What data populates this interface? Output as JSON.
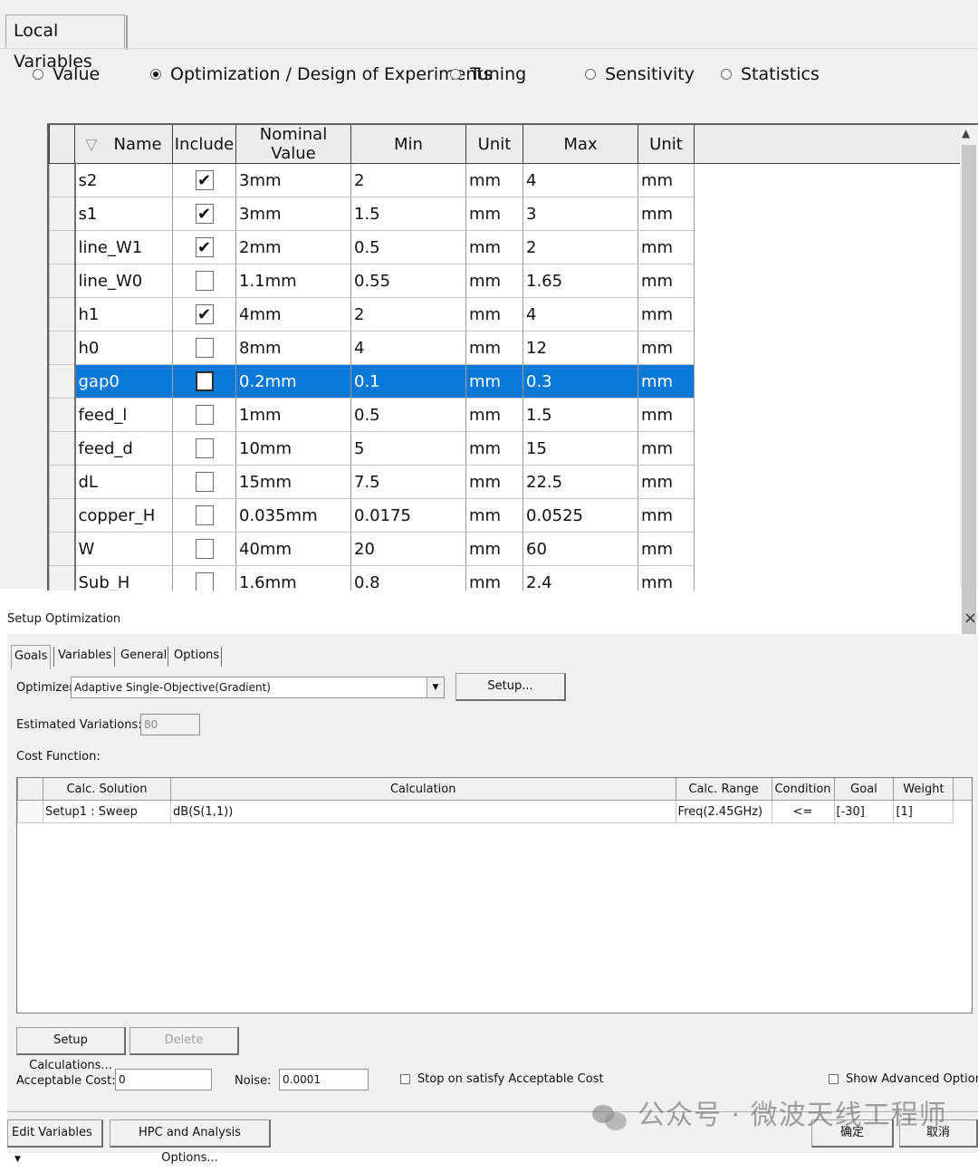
{
  "local_variables": {
    "tab_label": "Local Variables",
    "radio_options": [
      {
        "label": "Value",
        "selected": false
      },
      {
        "label": "Optimization / Design of Experiments",
        "selected": true
      },
      {
        "label": "Tuning",
        "selected": false
      },
      {
        "label": "Sensitivity",
        "selected": false
      },
      {
        "label": "Statistics",
        "selected": false
      }
    ],
    "columns": [
      "Name",
      "Include",
      "Nominal Value",
      "Min",
      "Unit",
      "Max",
      "Unit"
    ],
    "rows": [
      {
        "name": "s2",
        "include": true,
        "nominal": "3mm",
        "min": "2",
        "min_unit": "mm",
        "max": "4",
        "max_unit": "mm",
        "selected": false
      },
      {
        "name": "s1",
        "include": true,
        "nominal": "3mm",
        "min": "1.5",
        "min_unit": "mm",
        "max": "3",
        "max_unit": "mm",
        "selected": false
      },
      {
        "name": "line_W1",
        "include": true,
        "nominal": "2mm",
        "min": "0.5",
        "min_unit": "mm",
        "max": "2",
        "max_unit": "mm",
        "selected": false
      },
      {
        "name": "line_W0",
        "include": false,
        "nominal": "1.1mm",
        "min": "0.55",
        "min_unit": "mm",
        "max": "1.65",
        "max_unit": "mm",
        "selected": false
      },
      {
        "name": "h1",
        "include": true,
        "nominal": "4mm",
        "min": "2",
        "min_unit": "mm",
        "max": "4",
        "max_unit": "mm",
        "selected": false
      },
      {
        "name": "h0",
        "include": false,
        "nominal": "8mm",
        "min": "4",
        "min_unit": "mm",
        "max": "12",
        "max_unit": "mm",
        "selected": false
      },
      {
        "name": "gap0",
        "include": false,
        "nominal": "0.2mm",
        "min": "0.1",
        "min_unit": "mm",
        "max": "0.3",
        "max_unit": "mm",
        "selected": true
      },
      {
        "name": "feed_l",
        "include": false,
        "nominal": "1mm",
        "min": "0.5",
        "min_unit": "mm",
        "max": "1.5",
        "max_unit": "mm",
        "selected": false
      },
      {
        "name": "feed_d",
        "include": false,
        "nominal": "10mm",
        "min": "5",
        "min_unit": "mm",
        "max": "15",
        "max_unit": "mm",
        "selected": false
      },
      {
        "name": "dL",
        "include": false,
        "nominal": "15mm",
        "min": "7.5",
        "min_unit": "mm",
        "max": "22.5",
        "max_unit": "mm",
        "selected": false
      },
      {
        "name": "copper_H",
        "include": false,
        "nominal": "0.035mm",
        "min": "0.0175",
        "min_unit": "mm",
        "max": "0.0525",
        "max_unit": "mm",
        "selected": false
      },
      {
        "name": "W",
        "include": false,
        "nominal": "40mm",
        "min": "20",
        "min_unit": "mm",
        "max": "60",
        "max_unit": "mm",
        "selected": false
      },
      {
        "name": "Sub_H",
        "include": false,
        "nominal": "1.6mm",
        "min": "0.8",
        "min_unit": "mm",
        "max": "2.4",
        "max_unit": "mm",
        "selected": false
      }
    ],
    "selection_color": "#0a78d7"
  },
  "setup_optimization": {
    "title": "Setup Optimization",
    "close_glyph": "×",
    "tabs": [
      "Goals",
      "Variables",
      "General",
      "Options"
    ],
    "active_tab": "Goals",
    "optimizer_label": "Optimizer",
    "optimizer_value": "Adaptive Single-Objective(Gradient)",
    "setup_button": "Setup...",
    "estimated_variations_label": "Estimated Variations:",
    "estimated_variations_value": "80",
    "cost_function_label": "Cost Function:",
    "cost_columns": [
      "Calc. Solution",
      "Calculation",
      "Calc. Range",
      "Condition",
      "Goal",
      "Weight"
    ],
    "cost_rows": [
      {
        "solution": "Setup1 : Sweep",
        "calculation": "dB(S(1,1))",
        "range": "Freq(2.45GHz)",
        "condition": "<=",
        "goal": "[-30]",
        "weight": "[1]"
      }
    ],
    "setup_calculations_button": "Setup Calculations...",
    "delete_button": "Delete",
    "acceptable_cost_label": "Acceptable Cost:",
    "acceptable_cost_value": "0",
    "noise_label": "Noise:",
    "noise_value": "0.0001",
    "stop_on_satisfy_label": "Stop on satisfy Acceptable Cost",
    "show_advanced_label": "Show Advanced Optior",
    "edit_variables_button": "Edit Variables",
    "hpc_button": "HPC and Analysis Options...",
    "ok_button": "确定",
    "cancel_button": "取消"
  },
  "watermark": {
    "text": "公众号 · 微波天线工程师",
    "icon": "wechat-icon"
  }
}
